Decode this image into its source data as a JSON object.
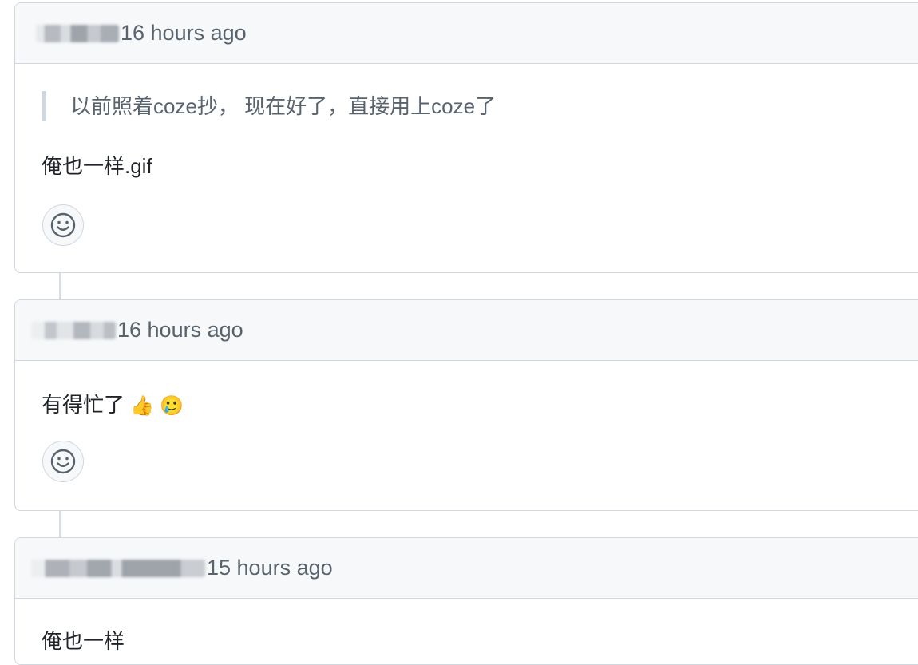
{
  "comments": [
    {
      "time": "16 hours ago",
      "quote": "以前照着coze抄， 现在好了，直接用上coze了",
      "body": "俺也一样.gif"
    },
    {
      "time": "16 hours ago",
      "body": "有得忙了",
      "emoji1": "👍",
      "emoji2": "🥲"
    },
    {
      "time": "15 hours ago",
      "body": "俺也一样"
    }
  ],
  "icons": {
    "reaction": "smiley-icon"
  }
}
